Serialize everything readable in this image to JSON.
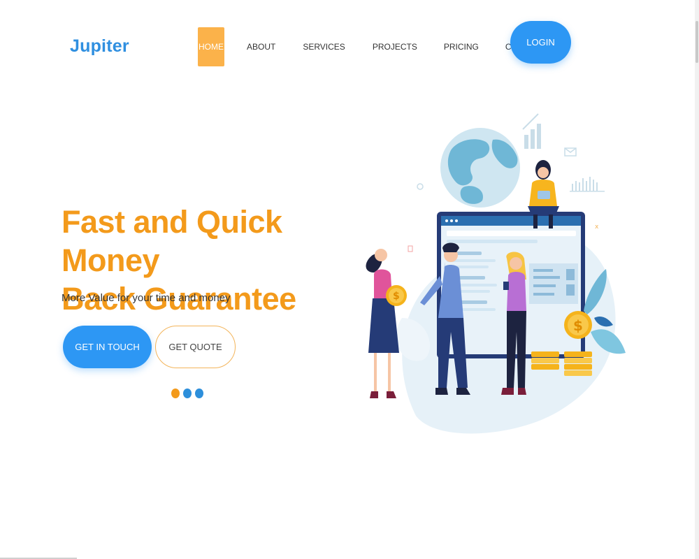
{
  "brand": {
    "name": "Jupiter"
  },
  "nav": {
    "items": [
      {
        "label": "HOME"
      },
      {
        "label": "ABOUT"
      },
      {
        "label": "SERVICES"
      },
      {
        "label": "PROJECTS"
      },
      {
        "label": "PRICING"
      },
      {
        "label": "CONTACT"
      }
    ],
    "active_index": 0,
    "login_label": "LOGIN"
  },
  "hero": {
    "title_line1": "Fast and Quick Money",
    "title_line2": "Back Guarantee",
    "subtitle": "More Value for your time and money",
    "cta_primary": "GET IN TOUCH",
    "cta_secondary": "GET QUOTE"
  },
  "slider": {
    "dot_count": 3,
    "active_index": 0
  },
  "illustration": {
    "coin_symbol": "$"
  },
  "colors": {
    "brand_blue": "#2f8fe0",
    "button_blue": "#2d97f4",
    "accent_orange": "#f39a1b",
    "nav_active": "#fbb24a",
    "dot_orange": "#f39a1b",
    "dot_blue": "#2d8fdb"
  },
  "icons": [
    "globe-icon",
    "chart-icon",
    "mail-icon",
    "coin-icon",
    "leaf-icon"
  ]
}
